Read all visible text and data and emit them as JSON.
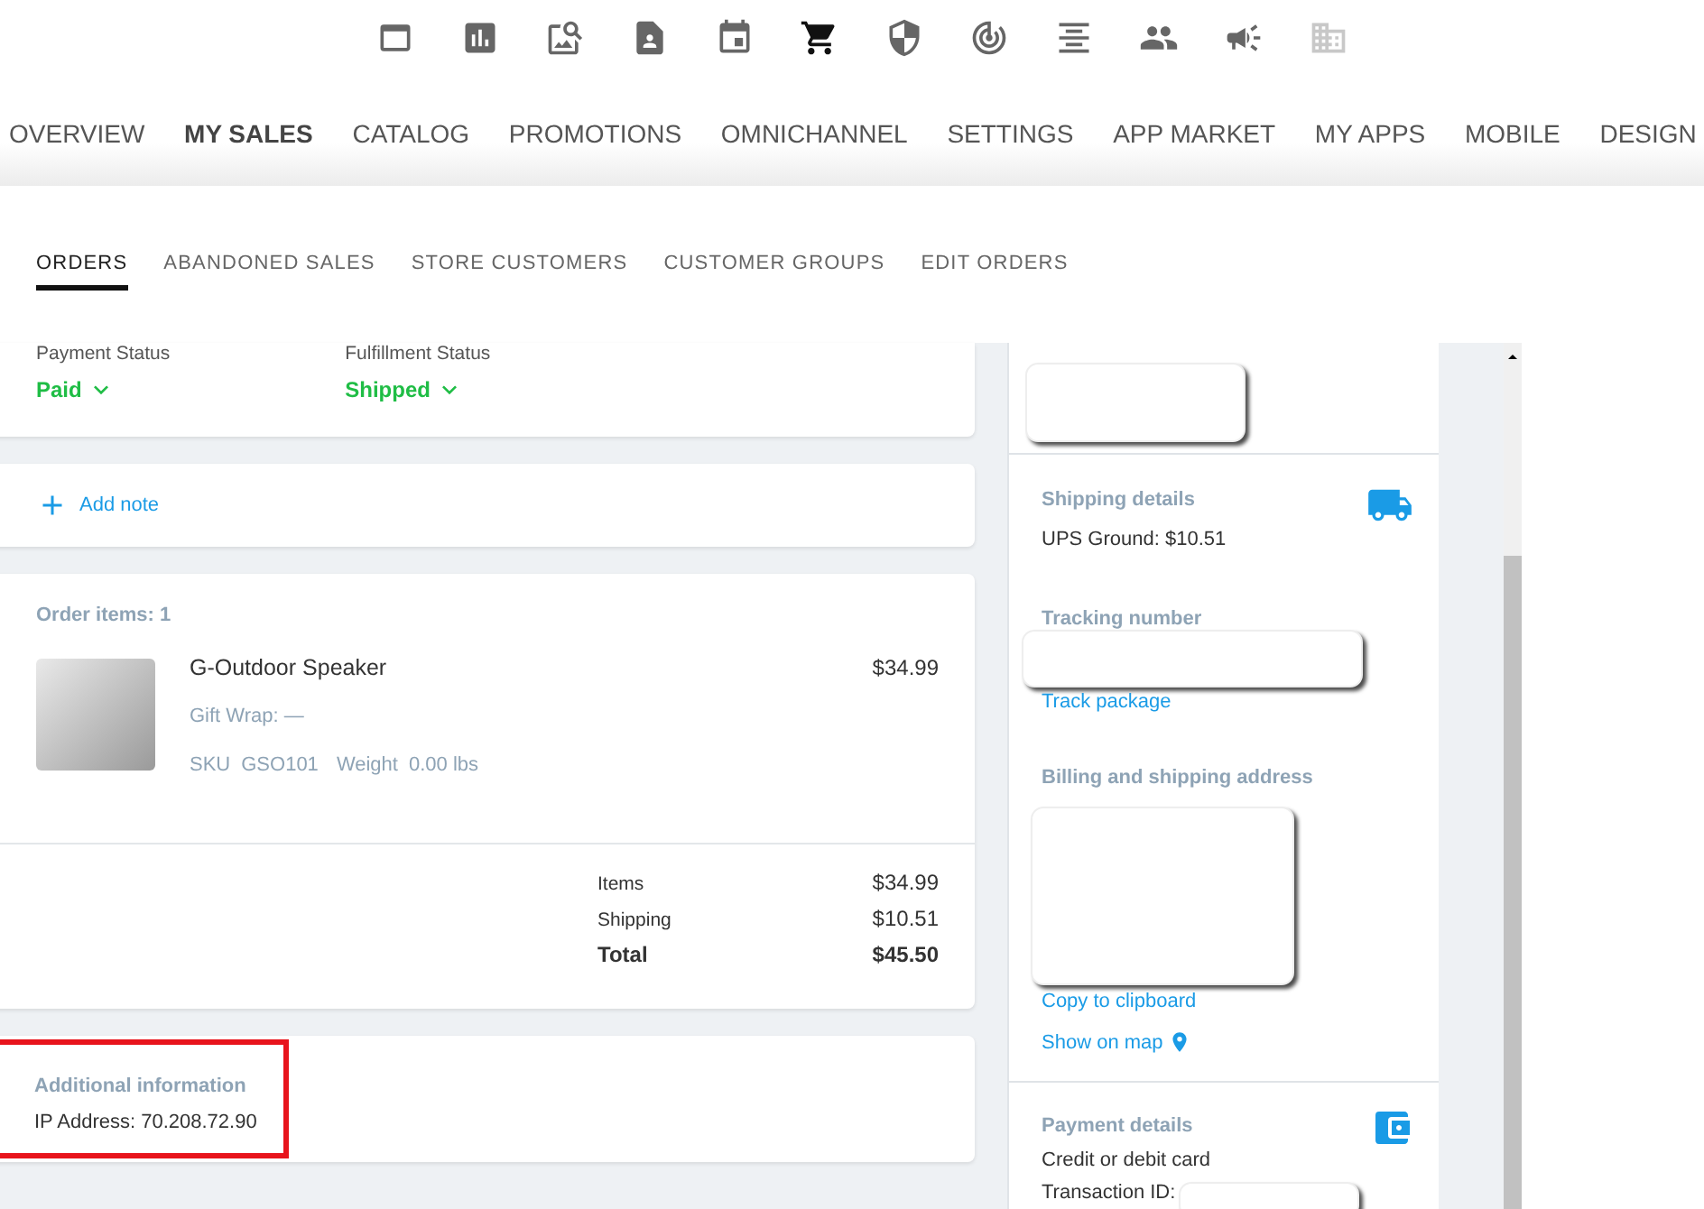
{
  "toolbar_icons": [
    {
      "kind": "window",
      "selected": false,
      "disabled": false
    },
    {
      "kind": "chart",
      "selected": false,
      "disabled": false
    },
    {
      "kind": "search",
      "selected": false,
      "disabled": false
    },
    {
      "kind": "contact",
      "selected": false,
      "disabled": false
    },
    {
      "kind": "calendar",
      "selected": false,
      "disabled": false
    },
    {
      "kind": "cart",
      "selected": true,
      "disabled": false
    },
    {
      "kind": "shield",
      "selected": false,
      "disabled": false
    },
    {
      "kind": "target",
      "selected": false,
      "disabled": false
    },
    {
      "kind": "align",
      "selected": false,
      "disabled": false
    },
    {
      "kind": "people",
      "selected": false,
      "disabled": false
    },
    {
      "kind": "megaphone",
      "selected": false,
      "disabled": false
    },
    {
      "kind": "building",
      "selected": false,
      "disabled": true
    }
  ],
  "main_nav": [
    {
      "label": "OVERVIEW",
      "selected": false
    },
    {
      "label": "MY SALES",
      "selected": true
    },
    {
      "label": "CATALOG",
      "selected": false
    },
    {
      "label": "PROMOTIONS",
      "selected": false
    },
    {
      "label": "OMNICHANNEL",
      "selected": false
    },
    {
      "label": "SETTINGS",
      "selected": false
    },
    {
      "label": "APP MARKET",
      "selected": false
    },
    {
      "label": "MY APPS",
      "selected": false
    },
    {
      "label": "MOBILE",
      "selected": false
    },
    {
      "label": "DESIGN",
      "selected": false
    }
  ],
  "sub_tabs": [
    {
      "label": "ORDERS",
      "selected": true
    },
    {
      "label": "ABANDONED SALES",
      "selected": false
    },
    {
      "label": "STORE CUSTOMERS",
      "selected": false
    },
    {
      "label": "CUSTOMER GROUPS",
      "selected": false
    },
    {
      "label": "EDIT ORDERS",
      "selected": false
    }
  ],
  "status_card": {
    "payment": {
      "label": "Payment Status",
      "value": "Paid"
    },
    "fulfillment": {
      "label": "Fulfillment Status",
      "value": "Shipped"
    }
  },
  "note_card": {
    "action": "Add note"
  },
  "order_items": {
    "title": "Order items: 1",
    "items": [
      {
        "name": "G-Outdoor Speaker",
        "price": "$34.99",
        "gift_wrap": "Gift Wrap: —",
        "sku_label": "SKU",
        "sku": "GSO101",
        "weight_label": "Weight",
        "weight": "0.00 lbs"
      }
    ],
    "totals": [
      {
        "label": "Items",
        "value": "$34.99",
        "kind": "normal"
      },
      {
        "label": "Shipping",
        "value": "$10.51",
        "kind": "normal"
      },
      {
        "label": "Total",
        "value": "$45.50",
        "kind": "total"
      }
    ]
  },
  "additional_info": {
    "title": "Additional information",
    "ip": "IP Address: 70.208.72.90",
    "highlighted": true
  },
  "side_panel": {
    "shipping": {
      "title": "Shipping details",
      "method": "UPS Ground: $10.51",
      "tracking_label": "Tracking number",
      "track_link": "Track package"
    },
    "address": {
      "title": "Billing and shipping address",
      "copy_link": "Copy to clipboard",
      "map_link": "Show on map"
    },
    "payment": {
      "title": "Payment details",
      "method": "Credit or debit card",
      "transaction_label": "Transaction ID:"
    }
  }
}
